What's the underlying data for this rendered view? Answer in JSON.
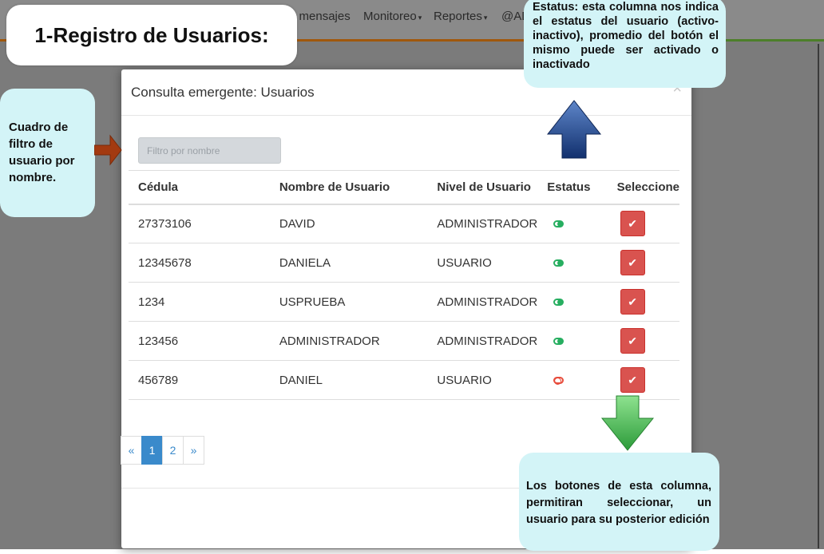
{
  "navbar": {
    "items": [
      {
        "label": "e mensajes",
        "caret": false
      },
      {
        "label": "Monitoreo",
        "caret": true
      },
      {
        "label": "Reportes",
        "caret": true
      },
      {
        "label": "@AD",
        "caret": false
      }
    ],
    "caret_glyph": "▾"
  },
  "modal": {
    "title": "Consulta emergente: Usuarios",
    "close": "×",
    "filter": {
      "placeholder": "Filtro por nombre",
      "value": ""
    },
    "columns": [
      "Cédula",
      "Nombre de Usuario",
      "Nivel de Usuario",
      "Estatus",
      "Seleccione"
    ],
    "rows": [
      {
        "cedula": "27373106",
        "nombre": "DAVID",
        "nivel": "ADMINISTRADOR",
        "estatus": "activo"
      },
      {
        "cedula": "12345678",
        "nombre": "DANIELA",
        "nivel": "USUARIO",
        "estatus": "activo"
      },
      {
        "cedula": "1234",
        "nombre": "USPRUEBA",
        "nivel": "ADMINISTRADOR",
        "estatus": "activo"
      },
      {
        "cedula": "123456",
        "nombre": "ADMINISTRADOR",
        "nivel": "ADMINISTRADOR",
        "estatus": "activo"
      },
      {
        "cedula": "456789",
        "nombre": "DANIEL",
        "nivel": "USUARIO",
        "estatus": "inactivo"
      }
    ],
    "select_icon": "✔",
    "pagination": {
      "prev": "«",
      "pages": [
        "1",
        "2"
      ],
      "active": "1",
      "next": "»"
    }
  },
  "callouts": {
    "title": "1-Registro de Usuarios:",
    "filter": "Cuadro de filtro de usuario por nombre.",
    "status": "Estatus: esta columna nos indica el estatus del usuario (activo-inactivo), promedio del botón el mismo puede ser activado o inactivado",
    "select": "Los botones de esta columna, permitiran seleccionar, un usuario para su posterior edición"
  },
  "colors": {
    "toggle_active": "#27ae60",
    "toggle_inactive": "#e74c3c",
    "select_button": "#d9534f",
    "pagination_active": "#3a8acb",
    "callout_bg": "#d3f4f7",
    "arrow_up": "#1b3f8b",
    "arrow_down": "#39b54a",
    "arrow_right": "#a33a10"
  },
  "icons": {
    "toggle": "toggle-icon",
    "select": "check-icon",
    "close": "close-icon"
  }
}
